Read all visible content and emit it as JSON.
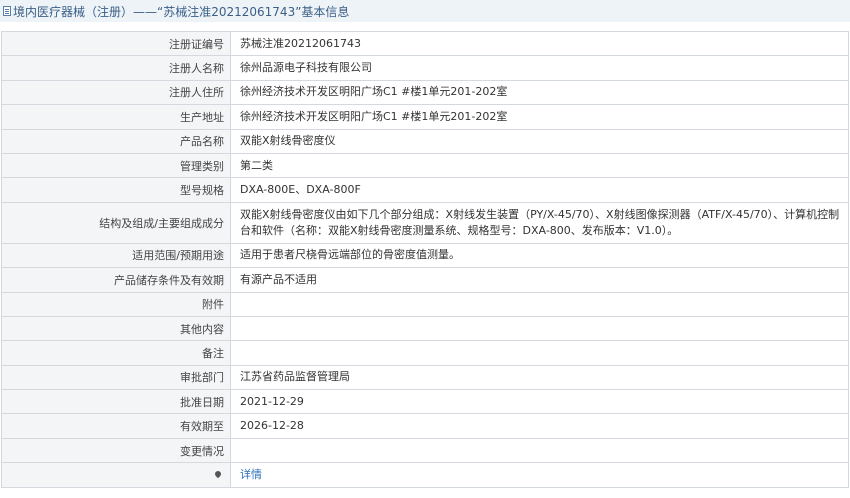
{
  "header": {
    "title": "境内医疗器械（注册）——“苏械注准20212061743”基本信息"
  },
  "rows": [
    {
      "label": "注册证编号",
      "value": "苏械注准20212061743"
    },
    {
      "label": "注册人名称",
      "value": "徐州品源电子科技有限公司"
    },
    {
      "label": "注册人住所",
      "value": "徐州经济技术开发区明阳广场C1 #楼1单元201-202室"
    },
    {
      "label": "生产地址",
      "value": "徐州经济技术开发区明阳广场C1 #楼1单元201-202室"
    },
    {
      "label": "产品名称",
      "value": "双能X射线骨密度仪"
    },
    {
      "label": "管理类别",
      "value": "第二类"
    },
    {
      "label": "型号规格",
      "value": "DXA-800E、DXA-800F"
    },
    {
      "label": "结构及组成/主要组成成分",
      "value": "双能X射线骨密度仪由如下几个部分组成：X射线发生装置（PY/X-45/70）、X射线图像探测器（ATF/X-45/70）、计算机控制台和软件（名称：双能X射线骨密度测量系统、规格型号：DXA-800、发布版本：V1.0）。"
    },
    {
      "label": "适用范围/预期用途",
      "value": "适用于患者尺桡骨远端部位的骨密度值测量。"
    },
    {
      "label": "产品储存条件及有效期",
      "value": "有源产品不适用"
    },
    {
      "label": "附件",
      "value": ""
    },
    {
      "label": "其他内容",
      "value": ""
    },
    {
      "label": "备注",
      "value": ""
    },
    {
      "label": "审批部门",
      "value": "江苏省药品监督管理局"
    },
    {
      "label": "批准日期",
      "value": "2021-12-29"
    },
    {
      "label": "有效期至",
      "value": "2026-12-28"
    },
    {
      "label": "变更情况",
      "value": ""
    }
  ],
  "footer_row": {
    "icon": "map-pin-icon",
    "label": "",
    "link": "详情"
  }
}
